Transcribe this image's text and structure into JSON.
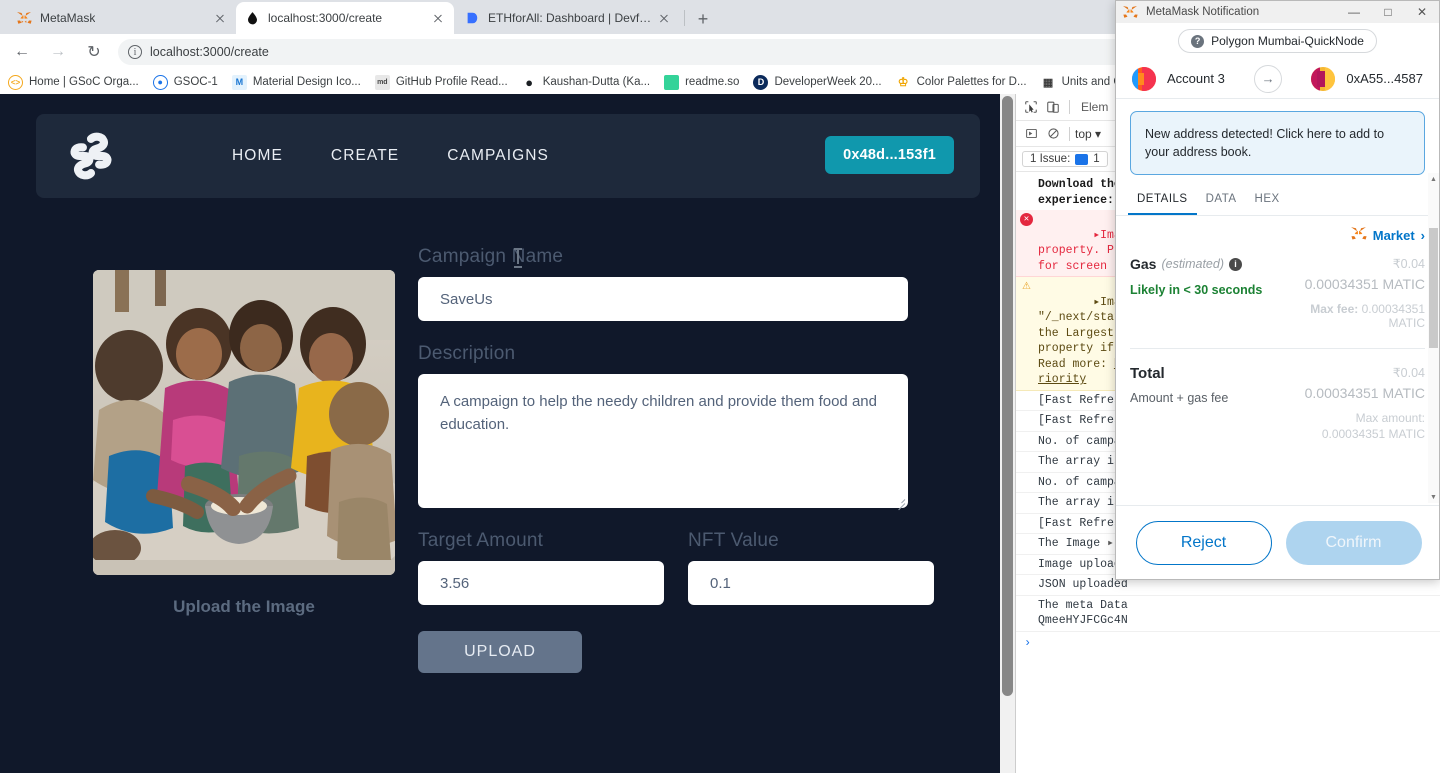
{
  "browser": {
    "tabs": [
      {
        "title": "MetaMask",
        "favicon": "metamask-fox-icon",
        "active": false
      },
      {
        "title": "localhost:3000/create",
        "favicon": "nextjs-drop-icon",
        "active": true
      },
      {
        "title": "ETHforAll: Dashboard | Devfolio",
        "favicon": "devfolio-icon",
        "active": false
      }
    ],
    "newtab_label": "+",
    "nav": {
      "back": "←",
      "forward": "→",
      "reload": "↻"
    },
    "omnibox": {
      "info_icon": "info-circle-icon",
      "url": "localhost:3000/create",
      "host": "localhost:3000",
      "path": "/create"
    },
    "bookmarks": [
      {
        "label": "Home | GSoC Orga...",
        "icon_letter": "‹›",
        "icon_color": "#f4a81d"
      },
      {
        "label": "GSOC-1",
        "icon_letter": "◉",
        "icon_color": "#1a73e8"
      },
      {
        "label": "Material Design Ico...",
        "icon_letter": "M",
        "icon_color": "#4fc3f7"
      },
      {
        "label": "GitHub Profile Read...",
        "icon_letter": "md",
        "icon_color": "#9e9e9e"
      },
      {
        "label": "Kaushan-Dutta (Ka...",
        "icon_letter": "●",
        "icon_color": "#1b1f23"
      },
      {
        "label": "readme.so",
        "icon_letter": "■",
        "icon_color": "#34d399"
      },
      {
        "label": "DeveloperWeek 20...",
        "icon_letter": "D",
        "icon_color": "#0b2a5b"
      },
      {
        "label": "Color Palettes for D...",
        "icon_letter": "♖",
        "icon_color": "#f0a500"
      },
      {
        "label": "Units and Glo",
        "icon_letter": "▦",
        "icon_color": "#3b3b3b"
      }
    ]
  },
  "app": {
    "logo_icon": "helping-hands-logo-icon",
    "nav_links": [
      "HOME",
      "CREATE",
      "CAMPAIGNS"
    ],
    "wallet_button": "0x48d...153f1",
    "wallet_button_color": "#1098ad",
    "background_color": "#10182a",
    "navbar_color": "#1e293b",
    "upload_caption": "Upload the Image",
    "image_alt": "children-sharing-food-photo",
    "form": {
      "campaign_name_label": "Campaign Name",
      "campaign_name_value": "SaveUs",
      "description_label": "Description",
      "description_value": "A campaign to help the needy children and provide them food and education.",
      "target_amount_label": "Target Amount",
      "target_amount_value": "3.56",
      "nft_value_label": "NFT Value",
      "nft_value_value": "0.1",
      "upload_button": "UPLOAD"
    }
  },
  "devtools": {
    "toolbar": {
      "inspect_icon": "inspect-cursor-icon",
      "device_icon": "device-toggle-icon",
      "elements_tab": "Elem",
      "step_icon": "step-into-icon",
      "clear_icon": "clear-console-icon",
      "context": "top ▾",
      "issue_label": "1 Issue:",
      "issue_count": "1"
    },
    "console_lines": [
      {
        "type": "info",
        "text": "Download the\nexperience: h",
        "link": true
      },
      {
        "type": "error",
        "badge": "✕",
        "text": "▸ Image is mi\nproperty. Ple\nfor screen re"
      },
      {
        "type": "warn",
        "badge": "!",
        "text": "▸ Image with\n\"/_next/stati\nthe Largest C\nproperty if t\nRead more: ht\nriority"
      },
      {
        "type": "log",
        "text": "[Fast Refresh"
      },
      {
        "type": "log",
        "text": "[Fast Refresh"
      },
      {
        "type": "log",
        "text": "No. of campai"
      },
      {
        "type": "log",
        "text": "The array is"
      },
      {
        "type": "log",
        "text": "No. of campai"
      },
      {
        "type": "log",
        "text": "The array is"
      },
      {
        "type": "log",
        "text": "[Fast Refresh"
      },
      {
        "type": "log",
        "text": "The Image ▸ F"
      },
      {
        "type": "log",
        "text": "Image uploade"
      },
      {
        "type": "log",
        "text": "JSON uploaded"
      },
      {
        "type": "log",
        "text": "The meta Data\nQmeeHYJFCGc4N"
      }
    ],
    "prompt": "›"
  },
  "metamask": {
    "window_title": "MetaMask Notification",
    "window_controls": {
      "minimize": "—",
      "maximize": "□",
      "close": "✕"
    },
    "network": "Polygon Mumbai-QuickNode",
    "network_icon": "question-mark-icon",
    "from_account": "Account 3",
    "to_account": "0xA55...4587",
    "transfer_arrow_icon": "arrow-right-icon",
    "banner": "New address detected! Click here to add to your address book.",
    "tabs": [
      "DETAILS",
      "DATA",
      "HEX"
    ],
    "active_tab": "DETAILS",
    "market_label": "Market",
    "market_chevron": "›",
    "gas_label": "Gas",
    "gas_estimated": "(estimated)",
    "gas_info_icon": "info-icon",
    "gas_fiat": "₹0.04",
    "gas_native": "0.00034351 MATIC",
    "likely_text": "Likely in < 30 seconds",
    "max_fee_label": "Max fee:",
    "max_fee_value": "0.00034351 MATIC",
    "total_label": "Total",
    "total_fiat": "₹0.04",
    "total_native": "0.00034351 MATIC",
    "total_sub": "Amount + gas fee",
    "max_amount_label": "Max amount:",
    "max_amount_value": "0.00034351 MATIC",
    "reject_button": "Reject",
    "confirm_button": "Confirm",
    "accent_color": "#0376c9",
    "green_color": "#1c8234"
  }
}
